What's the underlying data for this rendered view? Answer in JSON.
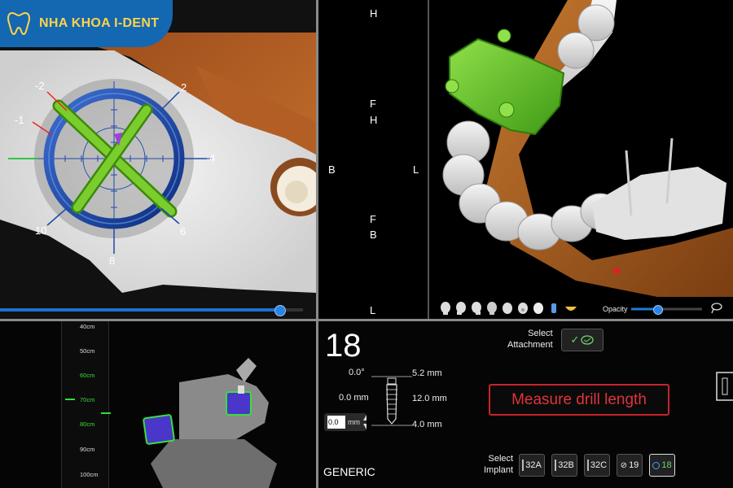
{
  "brand": {
    "name": "NHA KHOA I-DENT",
    "logo_icon": "tooth-logo-icon"
  },
  "slice_view": {
    "ring_labels": [
      "-2",
      "-1",
      "2",
      "4",
      "6",
      "8",
      "10"
    ],
    "slider_level_pct": 92
  },
  "orientation": {
    "H_top": "H",
    "F_upper": "F",
    "H_upper": "H",
    "B_left": "B",
    "L_right": "L",
    "F_lower": "F",
    "B_lower": "B",
    "L_bottom": "L"
  },
  "view_3d": {
    "view_buttons": [
      "head-front-icon",
      "head-left-icon",
      "head-right-icon",
      "head-back-icon",
      "head-top-icon",
      "head-bottom-icon",
      "head-iso-icon",
      "implant-icon",
      "smile-icon"
    ],
    "opacity_label": "Opacity",
    "opacity_level_pct": 45,
    "accent": "#1f7bd6"
  },
  "ruler": {
    "ticks": [
      {
        "label": "40cm",
        "green": false
      },
      {
        "label": "50cm",
        "green": false
      },
      {
        "label": "60cm",
        "green": true
      },
      {
        "label": "70cm",
        "green": true
      },
      {
        "label": "80cm",
        "green": true
      },
      {
        "label": "90cm",
        "green": false
      },
      {
        "label": "100cm",
        "green": false
      }
    ]
  },
  "implant_panel": {
    "tooth_number": "18",
    "angle": "0.0°",
    "offset": "0.0 mm",
    "top_width": "5.2 mm",
    "length": "12.0 mm",
    "bottom_width": "4.0 mm",
    "input_value": "0.0",
    "input_unit": "mm",
    "select_attachment_label": "Select\nAttachment",
    "select_implant_label": "Select\nImplant",
    "measure_label": "Measure drill length",
    "generic_label": "GENERIC",
    "implant_options": [
      "32A",
      "32B",
      "32C",
      "19",
      "18"
    ],
    "active_implant": "18",
    "colors": {
      "measure_red": "#e0343c",
      "active_green": "#6ed36e"
    }
  }
}
